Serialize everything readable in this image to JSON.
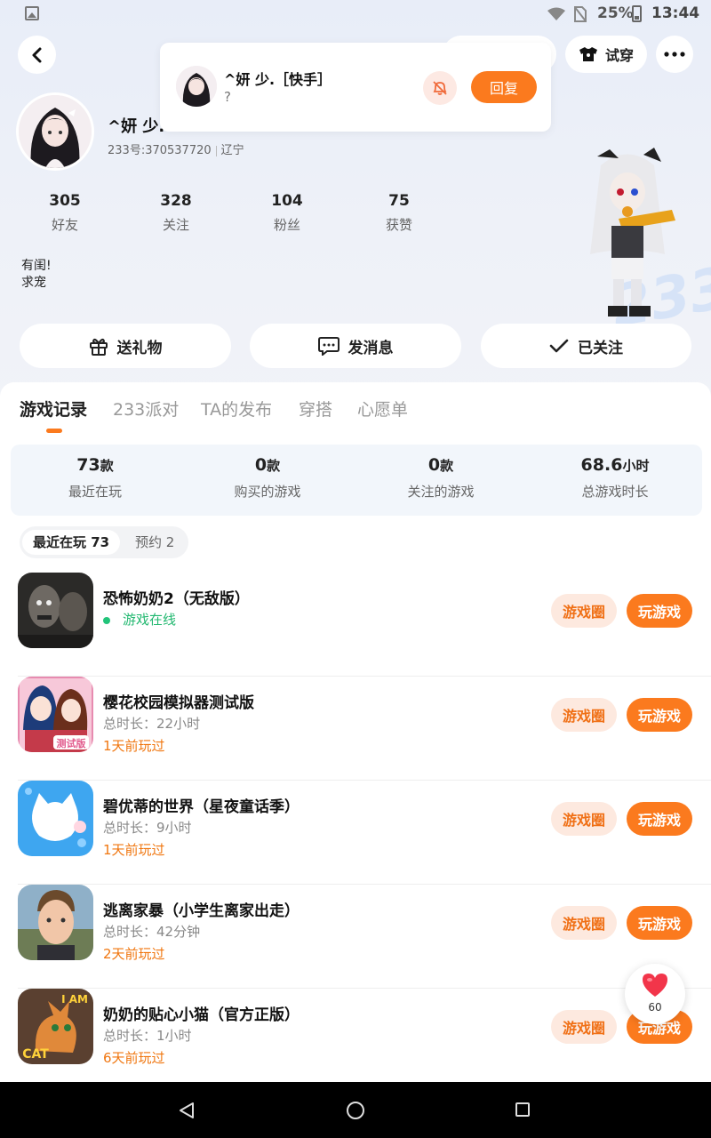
{
  "status_bar": {
    "battery": "25%",
    "time": "13:44"
  },
  "header": {
    "tryon_label": "试穿"
  },
  "profile": {
    "name": "^妍 少.",
    "id_text": "233号:370537720",
    "location": "辽宁",
    "bio_line1": "有闺!",
    "bio_line2": "求宠",
    "stats": [
      {
        "num": "305",
        "label": "好友"
      },
      {
        "num": "328",
        "label": "关注"
      },
      {
        "num": "104",
        "label": "粉丝"
      },
      {
        "num": "75",
        "label": "获赞"
      }
    ]
  },
  "actions": {
    "gift": "送礼物",
    "message": "发消息",
    "followed": "已关注"
  },
  "notification": {
    "name": "^妍 少.［快手］",
    "message": "?",
    "reply": "回复"
  },
  "tabs": [
    "游戏记录",
    "233派对",
    "TA的发布",
    "穿搭",
    "心愿单"
  ],
  "summary": [
    {
      "value": "73",
      "unit": "款",
      "label": "最近在玩"
    },
    {
      "value": "0",
      "unit": "款",
      "label": "购买的游戏"
    },
    {
      "value": "0",
      "unit": "款",
      "label": "关注的游戏"
    },
    {
      "value": "68.6",
      "unit": "小时",
      "label": "总游戏时长"
    }
  ],
  "filters": {
    "recent": "最近在玩 73",
    "reserve": "预约 2"
  },
  "games": [
    {
      "title": "恐怖奶奶2（无敌版）",
      "line2": "游戏在线",
      "line3": ""
    },
    {
      "title": "樱花校园模拟器测试版",
      "line2": "总时长：22小时",
      "line3": "1天前玩过"
    },
    {
      "title": "碧优蒂的世界（星夜童话季）",
      "line2": "总时长：9小时",
      "line3": "1天前玩过"
    },
    {
      "title": "逃离家暴（小学生离家出走）",
      "line2": "总时长：42分钟",
      "line3": "2天前玩过"
    },
    {
      "title": "奶奶的贴心小猫（官方正版）",
      "line2": "总时长：1小时",
      "line3": "6天前玩过"
    }
  ],
  "game_buttons": {
    "circle": "游戏圈",
    "play": "玩游戏"
  },
  "game_icon_text": {
    "test_badge": "测试版",
    "cat_top": "I AM",
    "cat_bottom": "CAT"
  },
  "float_like": {
    "count": "60"
  },
  "colors": {
    "accent": "#fb7a1e",
    "online": "#22c47a",
    "panel_bg": "#f2f6fb"
  }
}
